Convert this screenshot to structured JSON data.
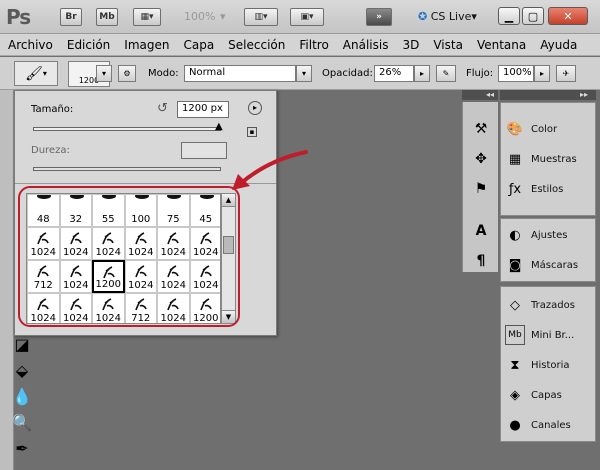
{
  "app": {
    "logo": "Ps",
    "bridge": "Br",
    "minibridge": "Mb",
    "zoom": "100%",
    "cslive": "CS Live"
  },
  "menu": [
    "Archivo",
    "Edición",
    "Imagen",
    "Capa",
    "Selección",
    "Filtro",
    "Análisis",
    "3D",
    "Vista",
    "Ventana",
    "Ayuda"
  ],
  "options": {
    "brush_size": "1200",
    "mode_label": "Modo:",
    "mode_value": "Normal",
    "opacity_label": "Opacidad:",
    "opacity_value": "26%",
    "flow_label": "Flujo:",
    "flow_value": "100%"
  },
  "brush_popup": {
    "size_label": "Tamaño:",
    "size_value": "1200 px",
    "hardness_label": "Dureza:",
    "hardness_value": "",
    "rows": [
      [
        "48",
        "32",
        "55",
        "100",
        "75",
        "45"
      ],
      [
        "1024",
        "1024",
        "1024",
        "1024",
        "1024",
        "1024"
      ],
      [
        "712",
        "1024",
        "1200",
        "1024",
        "1024",
        "1024"
      ],
      [
        "1024",
        "1024",
        "1024",
        "712",
        "1024",
        "1200"
      ],
      [
        "",
        "",
        "",
        "",
        "",
        ""
      ]
    ],
    "selected": "2,2"
  },
  "panels": {
    "group1": [
      "Color",
      "Muestras",
      "Estilos"
    ],
    "group2": [
      "Ajustes",
      "Máscaras"
    ],
    "group3": [
      "Trazados",
      "Mini Br...",
      "Historia",
      "Capas",
      "Canales"
    ]
  },
  "colors": {
    "highlight": "#c01d2c",
    "arrow": "#c01d2c"
  }
}
